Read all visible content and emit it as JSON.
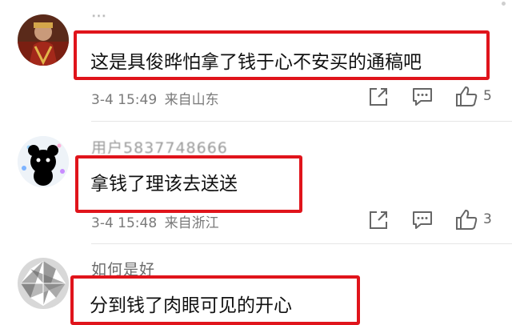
{
  "comments": [
    {
      "username": "…",
      "text": "这是具俊晔怕拿了钱于心不安买的通稿吧",
      "time": "3-4 15:49",
      "location": "来自山东",
      "likes": "5"
    },
    {
      "username": "用户5837748666",
      "text": "拿钱了理该去送送",
      "time": "3-4 15:48",
      "location": "来自浙江",
      "likes": "3"
    },
    {
      "username": "如何是好",
      "text": "分到钱了肉眼可见的开心"
    }
  ],
  "icons": {
    "share": "share-icon",
    "comment": "comment-icon",
    "like": "thumbs-up-icon"
  },
  "colors": {
    "highlight_border": "#e0141b",
    "meta_text": "#7a7a7a"
  }
}
